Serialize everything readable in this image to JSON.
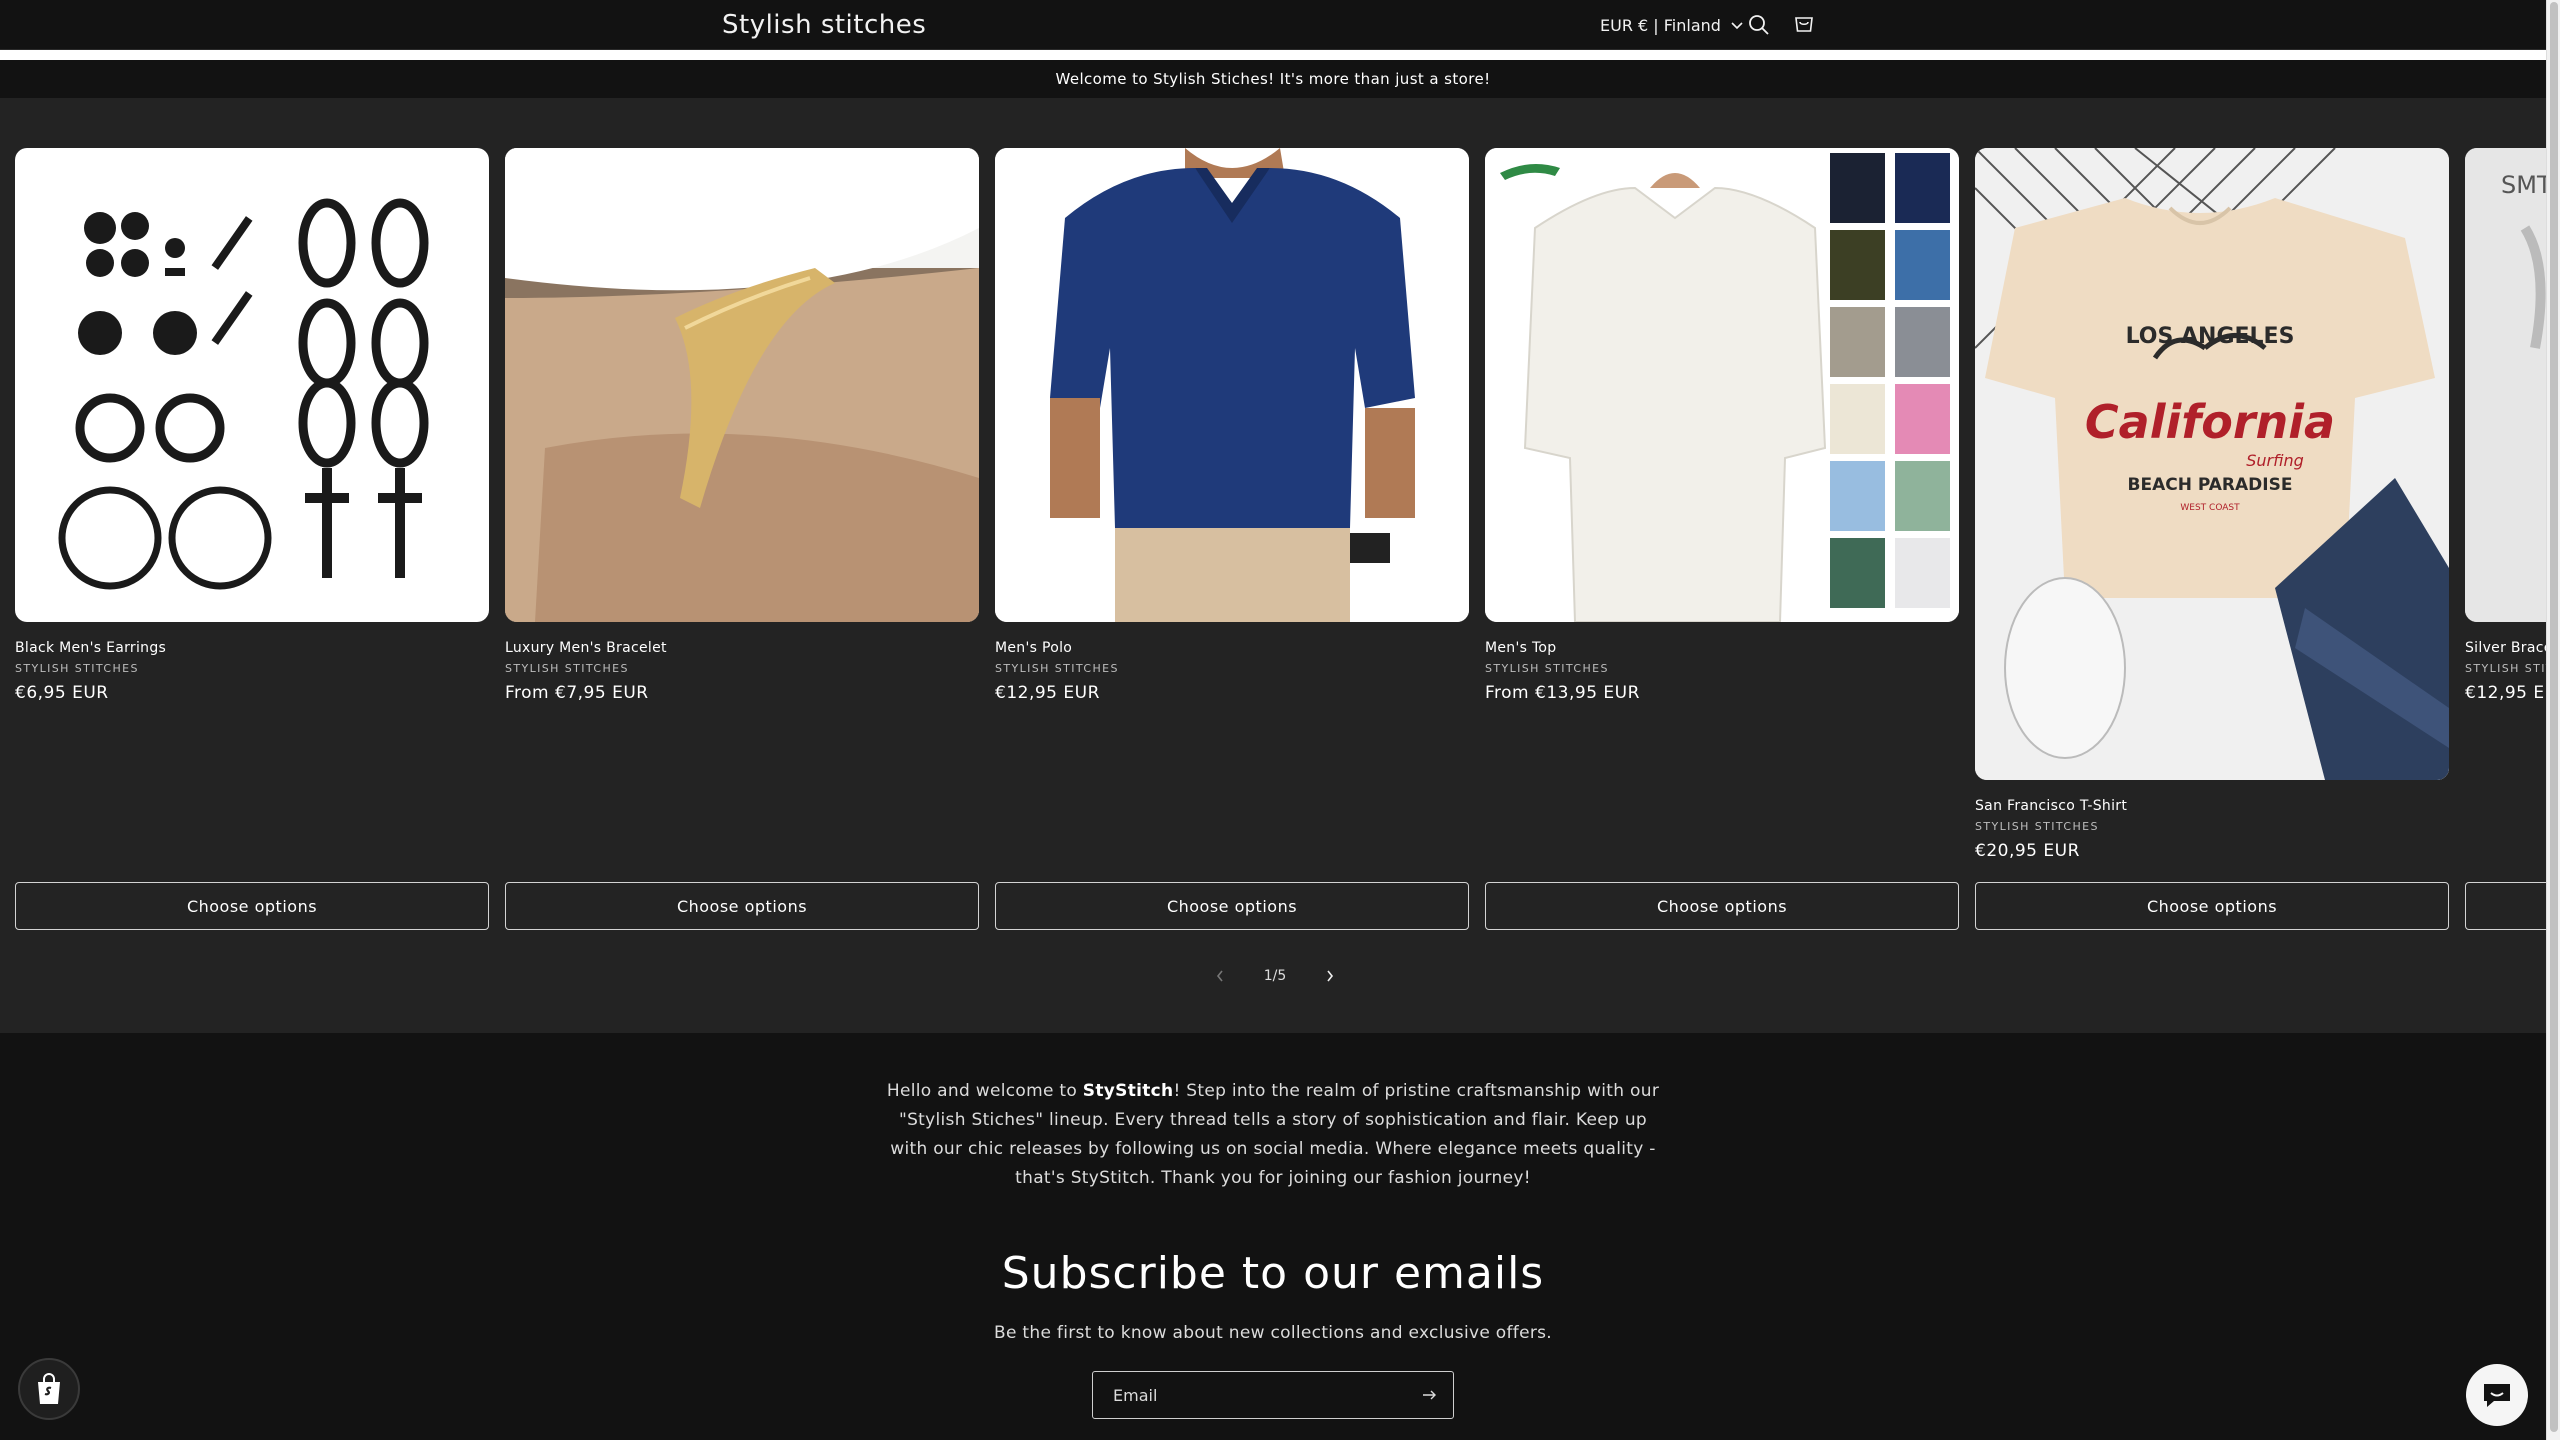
{
  "header": {
    "brand": "Stylish stitches",
    "currency": "EUR € | Finland",
    "icons": [
      "search-icon",
      "cart-icon",
      "chevron-down-icon"
    ]
  },
  "announcement": "Welcome to Stylish Stiches! It's more than just a store!",
  "products": [
    {
      "title": "Black Men's Earrings",
      "vendor": "STYLISH STITCHES",
      "price": "€6,95 EUR",
      "button": "Choose options"
    },
    {
      "title": "Luxury Men's Bracelet",
      "vendor": "STYLISH STITCHES",
      "price": "From €7,95 EUR",
      "button": "Choose options"
    },
    {
      "title": "Men's Polo",
      "vendor": "STYLISH STITCHES",
      "price": "€12,95 EUR",
      "button": "Choose options"
    },
    {
      "title": "Men's Top",
      "vendor": "STYLISH STITCHES",
      "price": "From €13,95 EUR",
      "button": "Choose options"
    },
    {
      "title": "San Francisco T-Shirt",
      "vendor": "STYLISH STITCHES",
      "price": "€20,95 EUR",
      "button": "Choose options"
    },
    {
      "title": "Silver Brace",
      "vendor": "STYLISH STIT",
      "price": "€12,95 EU",
      "button": ""
    }
  ],
  "image_text": {
    "tshirt": {
      "line1": "LOS ANGELES",
      "line2": "California",
      "line3": "Surfing",
      "line4": "BEACH PARADISE",
      "line5": "WEST COAST"
    },
    "partial": "SMT"
  },
  "pager": {
    "current": "1",
    "sep": "/",
    "total": "5"
  },
  "footer": {
    "about_pre": "Hello and welcome to ",
    "about_brand": "StyStitch",
    "about_post": "! Step into the realm of pristine craftsmanship with our \"Stylish Stiches\" lineup. Every thread tells a story of sophistication and flair. Keep up with our chic releases by following us on social media. Where elegance meets quality - that's StyStitch. Thank you for joining our fashion journey!",
    "subscribe_title": "Subscribe to our emails",
    "subscribe_text": "Be the first to know about new collections and exclusive offers.",
    "email_placeholder": "Email"
  },
  "colors": {
    "background": "#232323",
    "header": "#121212",
    "accent_polo": "#1f3a7a"
  }
}
